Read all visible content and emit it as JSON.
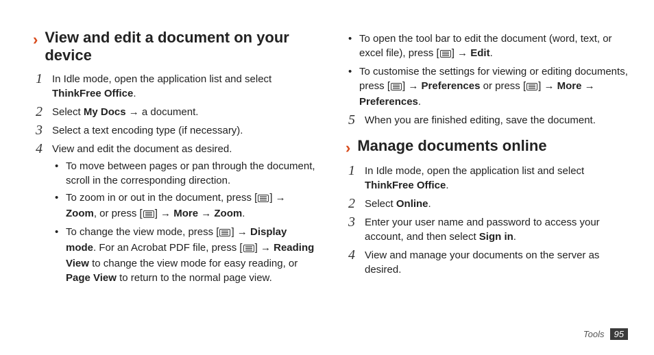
{
  "left": {
    "heading": "View and edit a document on your device",
    "steps": [
      {
        "num": "1",
        "parts": [
          {
            "t": "In Idle mode, open the application list and select "
          },
          {
            "t": "ThinkFree Office",
            "b": true
          },
          {
            "t": "."
          }
        ]
      },
      {
        "num": "2",
        "parts": [
          {
            "t": "Select "
          },
          {
            "t": "My Docs",
            "b": true
          },
          {
            "t": " → a document."
          }
        ]
      },
      {
        "num": "3",
        "parts": [
          {
            "t": "Select a text encoding type (if necessary)."
          }
        ]
      },
      {
        "num": "4",
        "parts": [
          {
            "t": "View and edit the document as desired."
          }
        ],
        "bullets": [
          [
            {
              "t": "To move between pages or pan through the document, scroll in the corresponding direction."
            }
          ],
          [
            {
              "t": "To zoom in or out in the document, press ["
            },
            {
              "icon": true
            },
            {
              "t": "] → "
            },
            {
              "t": "Zoom",
              "b": true
            },
            {
              "t": ", or press ["
            },
            {
              "icon": true
            },
            {
              "t": "] → "
            },
            {
              "t": "More",
              "b": true
            },
            {
              "t": " → "
            },
            {
              "t": "Zoom",
              "b": true
            },
            {
              "t": "."
            }
          ],
          [
            {
              "t": "To change the view mode, press ["
            },
            {
              "icon": true
            },
            {
              "t": "] → "
            },
            {
              "t": "Display mode",
              "b": true
            },
            {
              "t": ". For an Acrobat PDF file, press ["
            },
            {
              "icon": true
            },
            {
              "t": "] → "
            },
            {
              "t": "Reading View",
              "b": true
            },
            {
              "t": " to change the view mode for easy reading, or "
            },
            {
              "t": "Page View",
              "b": true
            },
            {
              "t": " to return to the normal page view."
            }
          ]
        ]
      }
    ]
  },
  "right": {
    "top_bullets": [
      [
        {
          "t": "To open the tool bar to edit the document (word, text, or excel file), press ["
        },
        {
          "icon": true
        },
        {
          "t": "] → "
        },
        {
          "t": "Edit",
          "b": true
        },
        {
          "t": "."
        }
      ],
      [
        {
          "t": "To customise the settings for viewing or editing documents, press ["
        },
        {
          "icon": true
        },
        {
          "t": "] → "
        },
        {
          "t": "Preferences",
          "b": true
        },
        {
          "t": " or press ["
        },
        {
          "icon": true
        },
        {
          "t": "] → "
        },
        {
          "t": "More",
          "b": true
        },
        {
          "t": " → "
        },
        {
          "t": "Preferences",
          "b": true
        },
        {
          "t": "."
        }
      ]
    ],
    "step5": {
      "num": "5",
      "parts": [
        {
          "t": "When you are finished editing, save the document."
        }
      ]
    },
    "heading": "Manage documents online",
    "steps": [
      {
        "num": "1",
        "parts": [
          {
            "t": "In Idle mode, open the application list and select "
          },
          {
            "t": "ThinkFree Office",
            "b": true
          },
          {
            "t": "."
          }
        ]
      },
      {
        "num": "2",
        "parts": [
          {
            "t": "Select "
          },
          {
            "t": "Online",
            "b": true
          },
          {
            "t": "."
          }
        ]
      },
      {
        "num": "3",
        "parts": [
          {
            "t": "Enter your user name and password to access your account, and then select "
          },
          {
            "t": "Sign in",
            "b": true
          },
          {
            "t": "."
          }
        ]
      },
      {
        "num": "4",
        "parts": [
          {
            "t": "View and manage your documents on the server as desired."
          }
        ]
      }
    ]
  },
  "chevron": "›",
  "footer": {
    "section": "Tools",
    "page": "95"
  }
}
